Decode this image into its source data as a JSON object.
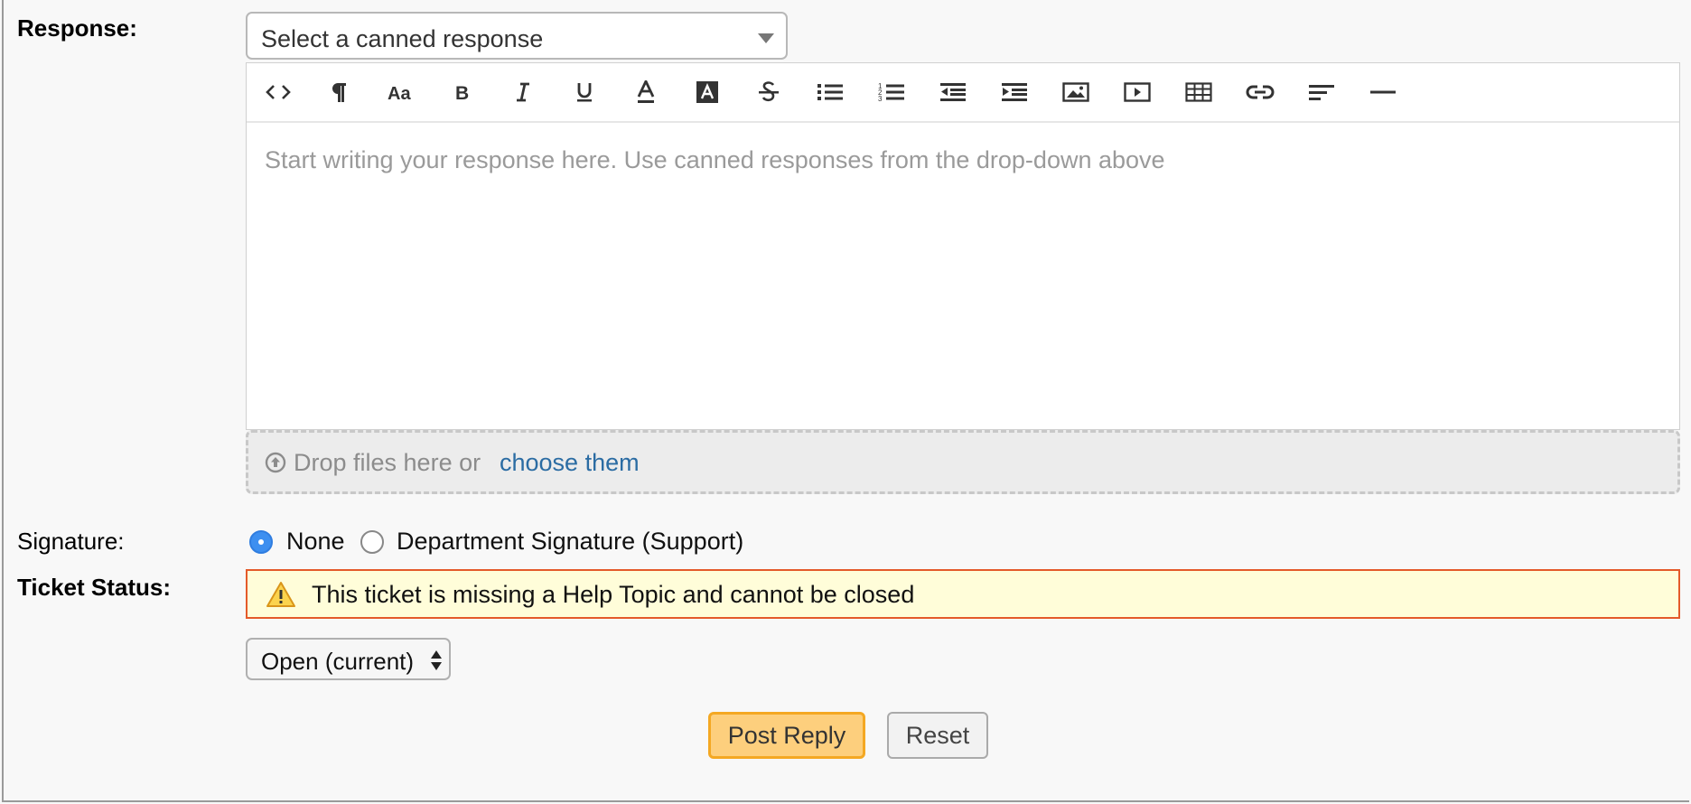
{
  "labels": {
    "response": "Response:",
    "signature": "Signature:",
    "ticket_status": "Ticket Status:"
  },
  "canned_select": {
    "value": "Select a canned response"
  },
  "editor": {
    "toolbar": [
      {
        "name": "html-icon",
        "glyph": "<>"
      },
      {
        "name": "paragraph-icon",
        "glyph": "¶"
      },
      {
        "name": "font-size-icon",
        "glyph": "Aa"
      },
      {
        "name": "bold-icon",
        "glyph": "B"
      },
      {
        "name": "italic-icon",
        "glyph": "I"
      },
      {
        "name": "underline-icon",
        "glyph": "U"
      },
      {
        "name": "font-color-icon",
        "glyph": "A"
      },
      {
        "name": "background-color-icon",
        "glyph": "A"
      },
      {
        "name": "strikethrough-icon",
        "glyph": "S"
      },
      {
        "name": "unordered-list-icon",
        "glyph": ""
      },
      {
        "name": "ordered-list-icon",
        "glyph": ""
      },
      {
        "name": "outdent-icon",
        "glyph": ""
      },
      {
        "name": "indent-icon",
        "glyph": ""
      },
      {
        "name": "image-icon",
        "glyph": ""
      },
      {
        "name": "video-icon",
        "glyph": ""
      },
      {
        "name": "table-icon",
        "glyph": ""
      },
      {
        "name": "link-icon",
        "glyph": ""
      },
      {
        "name": "align-icon",
        "glyph": ""
      },
      {
        "name": "horizontal-rule-icon",
        "glyph": ""
      }
    ],
    "placeholder": "Start writing your response here. Use canned responses from the drop-down above"
  },
  "dropzone": {
    "text": "Drop files here or",
    "link": "choose them"
  },
  "signature": {
    "options": [
      {
        "label": "None",
        "selected": true
      },
      {
        "label": "Department Signature (Support)",
        "selected": false
      }
    ]
  },
  "warning": {
    "text": "This ticket is missing a Help Topic and cannot be closed"
  },
  "status_select": {
    "value": "Open (current)"
  },
  "buttons": {
    "post": "Post Reply",
    "reset": "Reset"
  },
  "colors": {
    "accent_radio": "#3d8ff0",
    "post_button": "#fdcf7d",
    "warning_border": "#e45a2a",
    "warning_bg": "#fffdd9",
    "link": "#2b6ca3"
  }
}
